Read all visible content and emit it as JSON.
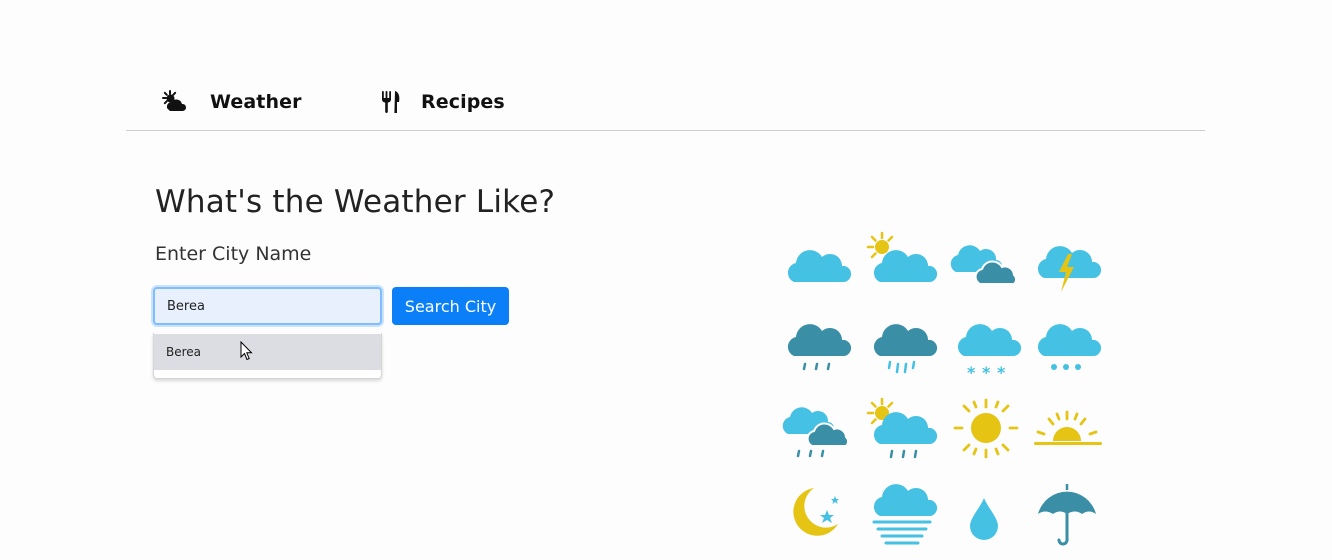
{
  "nav": {
    "items": [
      {
        "label": "Weather",
        "icon": "sun-cloud-icon"
      },
      {
        "label": "Recipes",
        "icon": "fork-knife-icon"
      }
    ]
  },
  "main": {
    "title": "What's the Weather Like?",
    "subtitle": "Enter City Name",
    "search_input": {
      "value": "Berea",
      "placeholder": ""
    },
    "search_button": "Search City",
    "autocomplete": [
      "Berea"
    ]
  },
  "weather_icons": [
    "cloud-icon",
    "partly-sunny-icon",
    "overcast-icon",
    "thunderstorm-icon",
    "rain-icon",
    "heavy-rain-icon",
    "snow-icon",
    "hail-icon",
    "rain-showers-icon",
    "sun-shower-icon",
    "sun-icon",
    "sunset-icon",
    "night-icon",
    "fog-icon",
    "raindrop-icon",
    "umbrella-icon"
  ],
  "colors": {
    "primary": "#0a7ff7",
    "cloud_light": "#45c1e3",
    "cloud_dark": "#3a8fa6",
    "sun": "#e5c414"
  }
}
